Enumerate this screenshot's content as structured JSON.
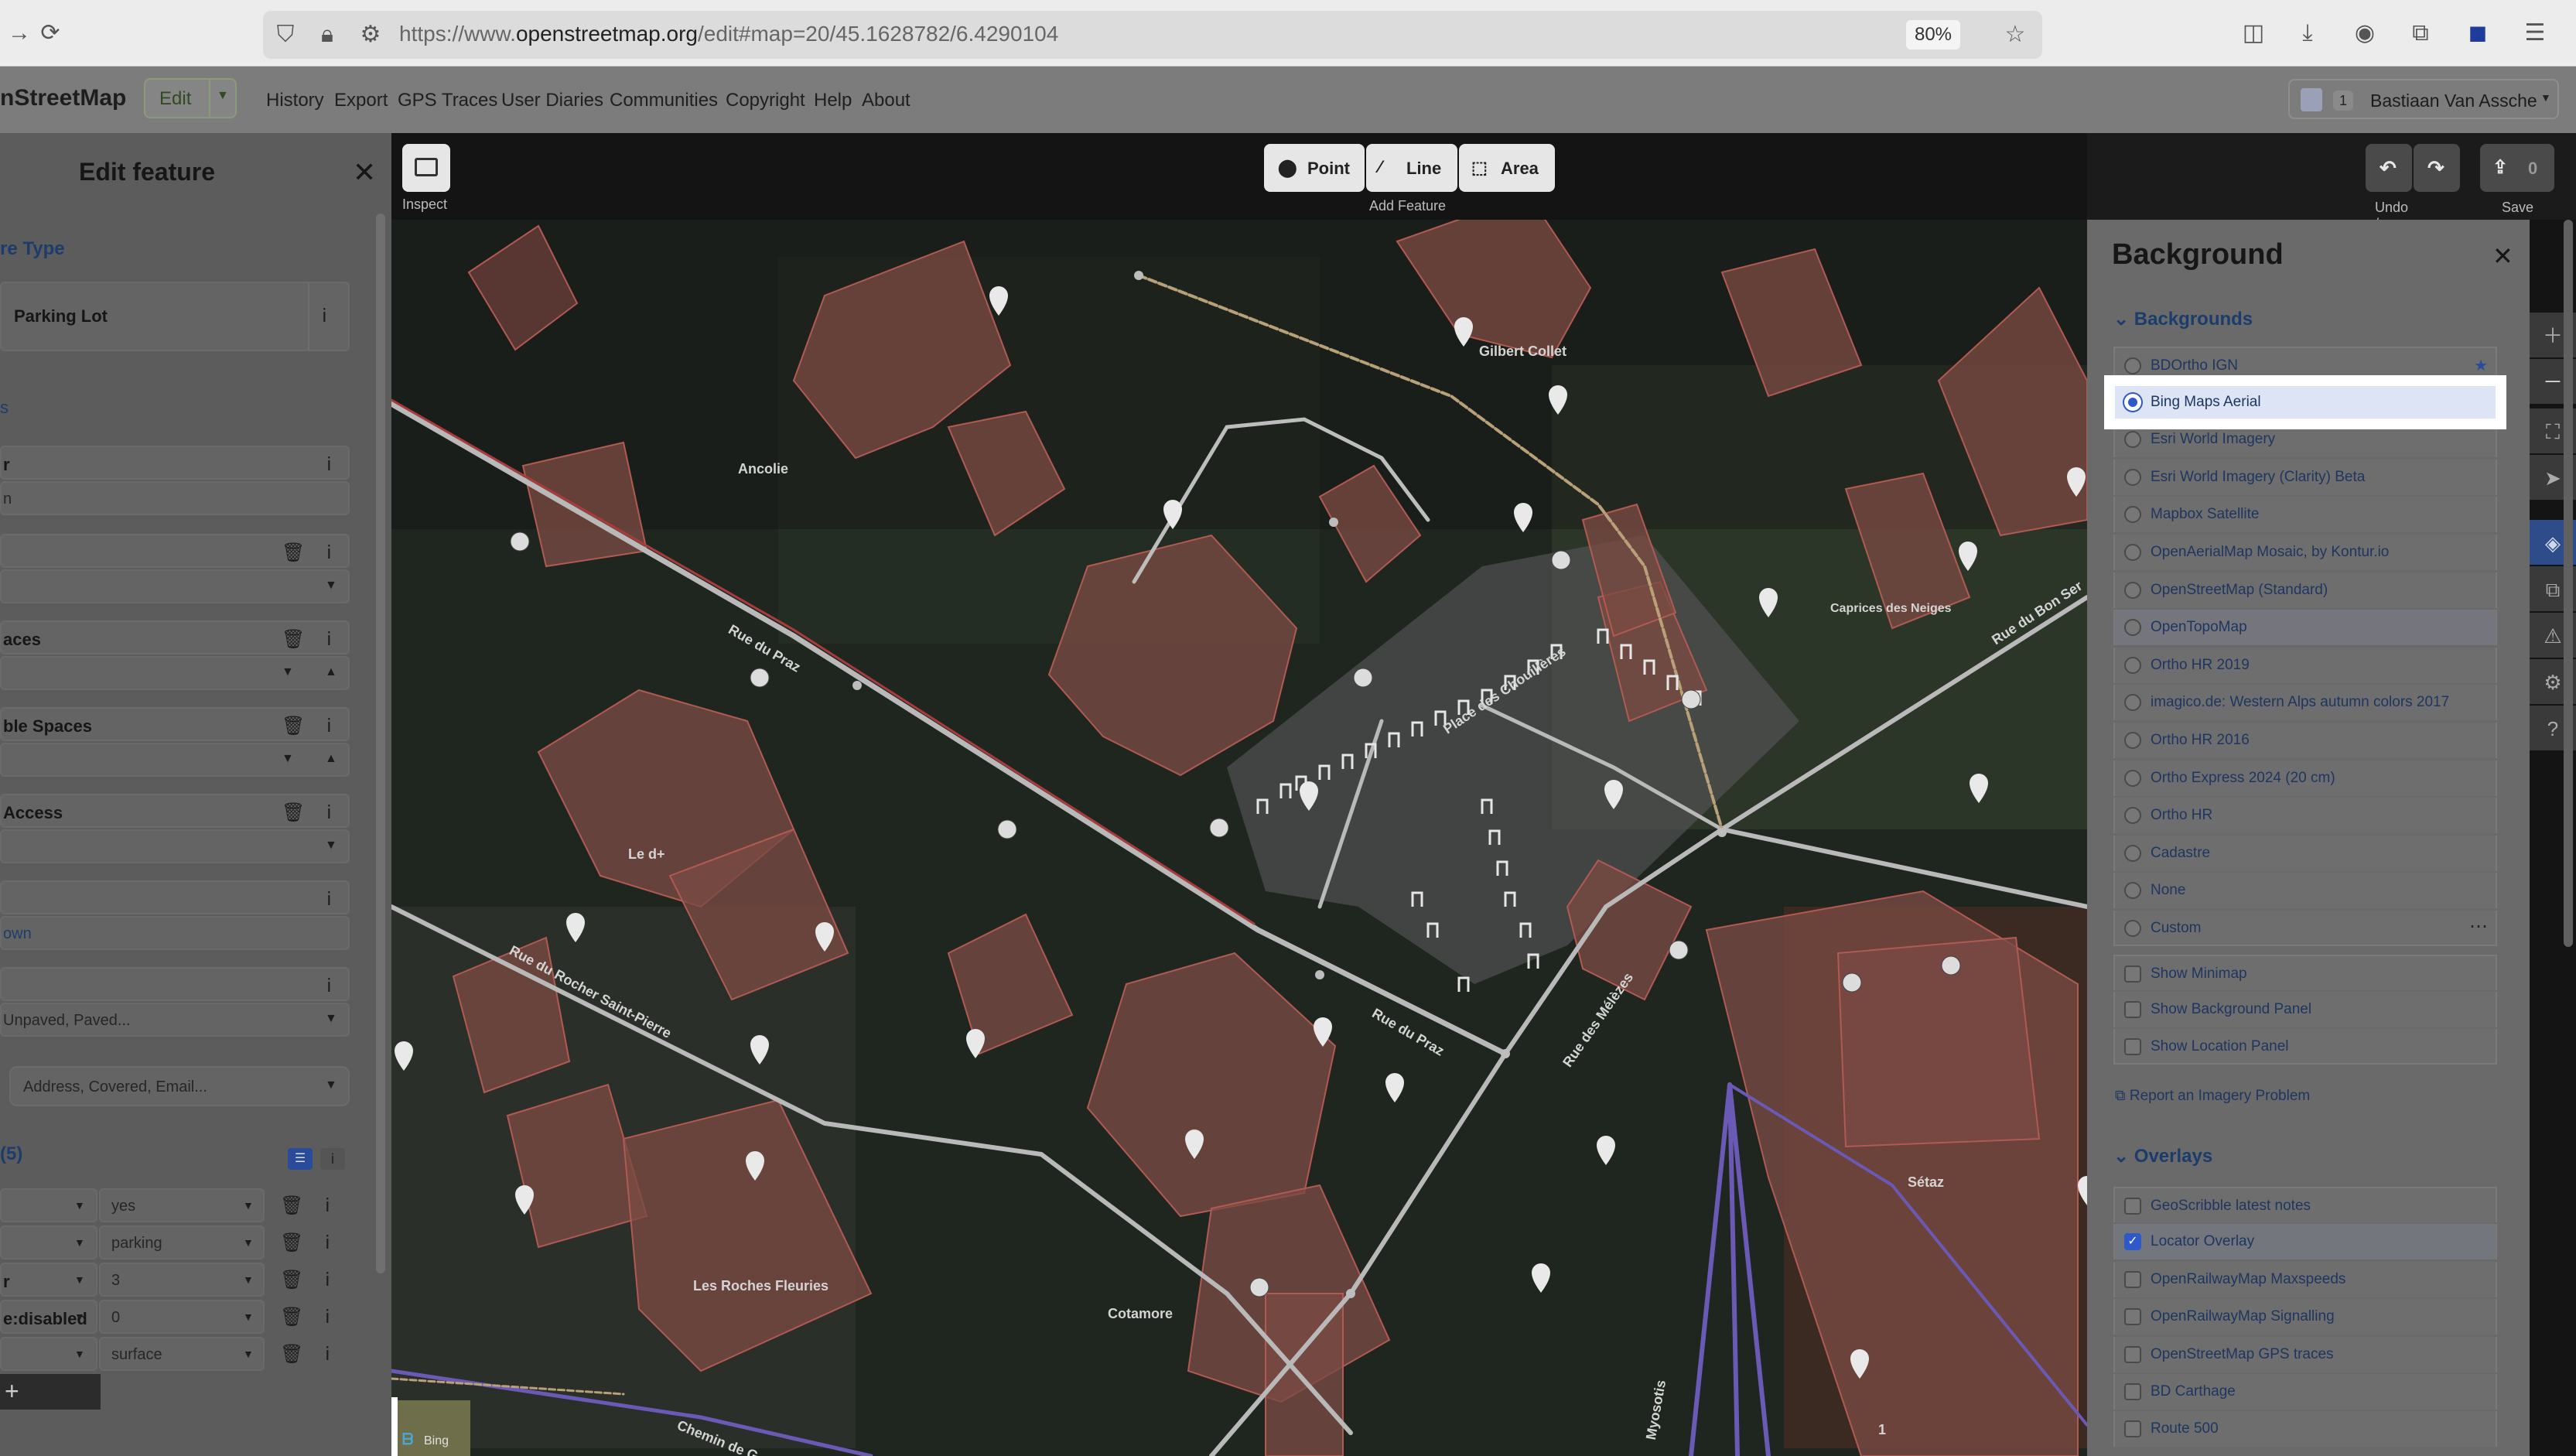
{
  "browser": {
    "url_prefix": "https://www.",
    "url_domain": "openstreetmap.org",
    "url_path": "/edit#map=20/45.1628782/6.4290104",
    "zoom": "80%"
  },
  "osm_nav": {
    "brand": "nStreetMap",
    "edit_label": "Edit",
    "links": [
      "History",
      "Export",
      "GPS Traces",
      "User Diaries",
      "Communities",
      "Copyright",
      "Help",
      "About"
    ],
    "user_count": "1",
    "user_name": "Bastiaan Van Assche"
  },
  "sidebar": {
    "title": "Edit feature",
    "feature_type_heading": "re Type",
    "preset_name": "Parking Lot",
    "fields": [
      {
        "label": "r",
        "value": "n"
      },
      {
        "label": "",
        "value": ""
      },
      {
        "label": "aces",
        "value": ""
      },
      {
        "label": "ble Spaces",
        "value": ""
      },
      {
        "label": " Access",
        "value": ""
      },
      {
        "label": "",
        "value": ""
      }
    ],
    "link_down": "own",
    "surface_placeholder": "Unpaved, Paved...",
    "add_field_placeholder": "Address, Covered, Email...",
    "tags_heading": "(5)",
    "tags": [
      {
        "key": "",
        "value": "yes"
      },
      {
        "key": "",
        "value": "parking"
      },
      {
        "key": "r",
        "value": "3"
      },
      {
        "key": "e:disabled",
        "value": "0"
      },
      {
        "key": "",
        "value": "surface"
      }
    ],
    "add_tag": "+"
  },
  "map": {
    "toolbar": {
      "inspect_label": "Inspect",
      "point": "Point",
      "line": "Line",
      "area": "Area",
      "add_feature_label": "Add Feature",
      "undo_redo_label": "Undo / Redo",
      "save_label": "Save",
      "save_count": "0"
    },
    "labels": {
      "gilbert_collet": "Gilbert Collet",
      "ancolie": "Ancolie",
      "caprices_des_neiges": "Caprices des Neiges",
      "rue_du_praz_1": "Rue du Praz",
      "rue_du_bon_ser": "Rue du Bon Ser",
      "place_des_chouilleres": "Place des Chouillères",
      "le_d": "Le d+",
      "rue_du_rocher": "Rue du Rocher Saint-Pierre",
      "rue_du_praz_2": "Rue du Praz",
      "rue_des_melezes": "Rue des Mélèzes",
      "setaz": "Sétaz",
      "les_roches_fleuries": "Les Roches Fleuries",
      "cotamore": "Cotamore",
      "chemin": "Chemin de G",
      "myosotis": "Myosotis",
      "attribution": "Bing",
      "badge_one": "1"
    }
  },
  "background_panel": {
    "title": "Background",
    "backgrounds_heading": "Backgrounds",
    "backgrounds": [
      {
        "name": "BDOrtho IGN",
        "selected": false
      },
      {
        "name": "Bing Maps Aerial",
        "selected": true
      },
      {
        "name": "Esri World Imagery",
        "selected": false
      },
      {
        "name": "Esri World Imagery (Clarity) Beta",
        "selected": false
      },
      {
        "name": "Mapbox Satellite",
        "selected": false
      },
      {
        "name": "OpenAerialMap Mosaic, by Kontur.io",
        "selected": false
      },
      {
        "name": "OpenStreetMap (Standard)",
        "selected": false
      },
      {
        "name": "OpenTopoMap",
        "selected": false
      },
      {
        "name": "Ortho HR 2019",
        "selected": false
      },
      {
        "name": "imagico.de: Western Alps autumn colors 2017",
        "selected": false
      },
      {
        "name": "Ortho HR 2016",
        "selected": false
      },
      {
        "name": "Ortho Express 2024 (20 cm)",
        "selected": false
      },
      {
        "name": "Ortho HR",
        "selected": false
      },
      {
        "name": "Cadastre",
        "selected": false
      },
      {
        "name": "None",
        "selected": false
      },
      {
        "name": "Custom",
        "selected": false
      }
    ],
    "display_options": [
      {
        "name": "Show Minimap",
        "checked": false
      },
      {
        "name": "Show Background Panel",
        "checked": false
      },
      {
        "name": "Show Location Panel",
        "checked": false
      }
    ],
    "report_link": "Report an Imagery Problem",
    "overlays_heading": "Overlays",
    "overlays": [
      {
        "name": "GeoScribble latest notes",
        "checked": false
      },
      {
        "name": "Locator Overlay",
        "checked": true
      },
      {
        "name": "OpenRailwayMap Maxspeeds",
        "checked": false
      },
      {
        "name": "OpenRailwayMap Signalling",
        "checked": false
      },
      {
        "name": "OpenStreetMap GPS traces",
        "checked": false
      },
      {
        "name": "BD Carthage",
        "checked": false
      },
      {
        "name": "Route 500",
        "checked": false
      }
    ]
  },
  "colors": {
    "highlight": "#ffffff",
    "selected_row": "#dce4f5",
    "building_fill": "#8a5048",
    "link_blue": "#1e3660"
  }
}
